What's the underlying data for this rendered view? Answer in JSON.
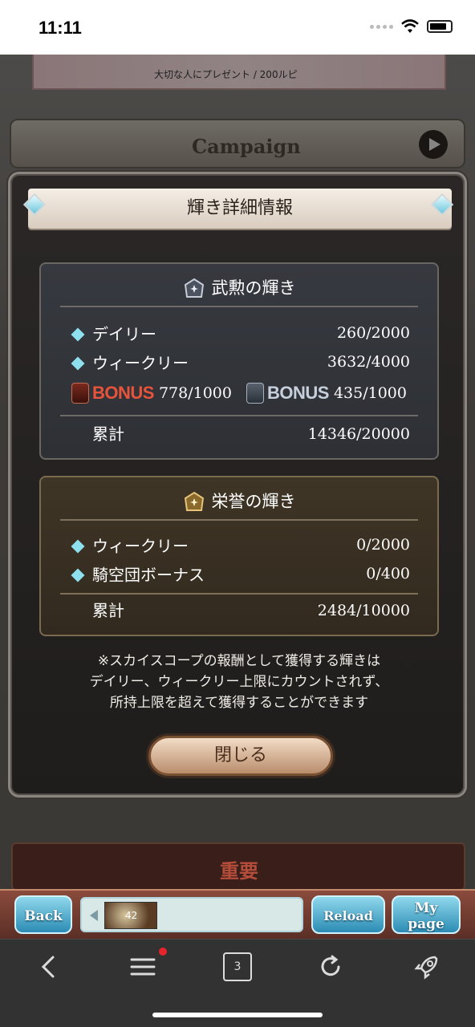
{
  "status_bar": {
    "time": "11:11"
  },
  "background": {
    "banner_text": "大切な人にプレゼント / 200ルピ",
    "campaign_label": "Campaign",
    "important_label": "重要"
  },
  "modal": {
    "title": "輝き詳細情報",
    "section_a": {
      "title": "武勲の輝き",
      "daily_label": "デイリー",
      "daily_value": "260/2000",
      "weekly_label": "ウィークリー",
      "weekly_value": "3632/4000",
      "bonus1_word": "BONUS",
      "bonus1_value": "778/1000",
      "bonus2_word": "BONUS",
      "bonus2_value": "435/1000",
      "total_label": "累計",
      "total_value": "14346/20000"
    },
    "section_b": {
      "title": "栄誉の輝き",
      "weekly_label": "ウィークリー",
      "weekly_value": "0/2000",
      "crew_label": "騎空団ボーナス",
      "crew_value": "0/400",
      "total_label": "累計",
      "total_value": "2484/10000"
    },
    "note_line1": "※スカイスコープの報酬として獲得する輝きは",
    "note_line2": "デイリー、ウィークリー上限にカウントされず、",
    "note_line3": "所持上限を超えて獲得することができます",
    "close_label": "閉じる"
  },
  "game_nav": {
    "back_label": "Back",
    "reload_label": "Reload",
    "mypage_line1": "My",
    "mypage_line2": "page",
    "level": "42"
  },
  "browser": {
    "tab_count": "3"
  }
}
